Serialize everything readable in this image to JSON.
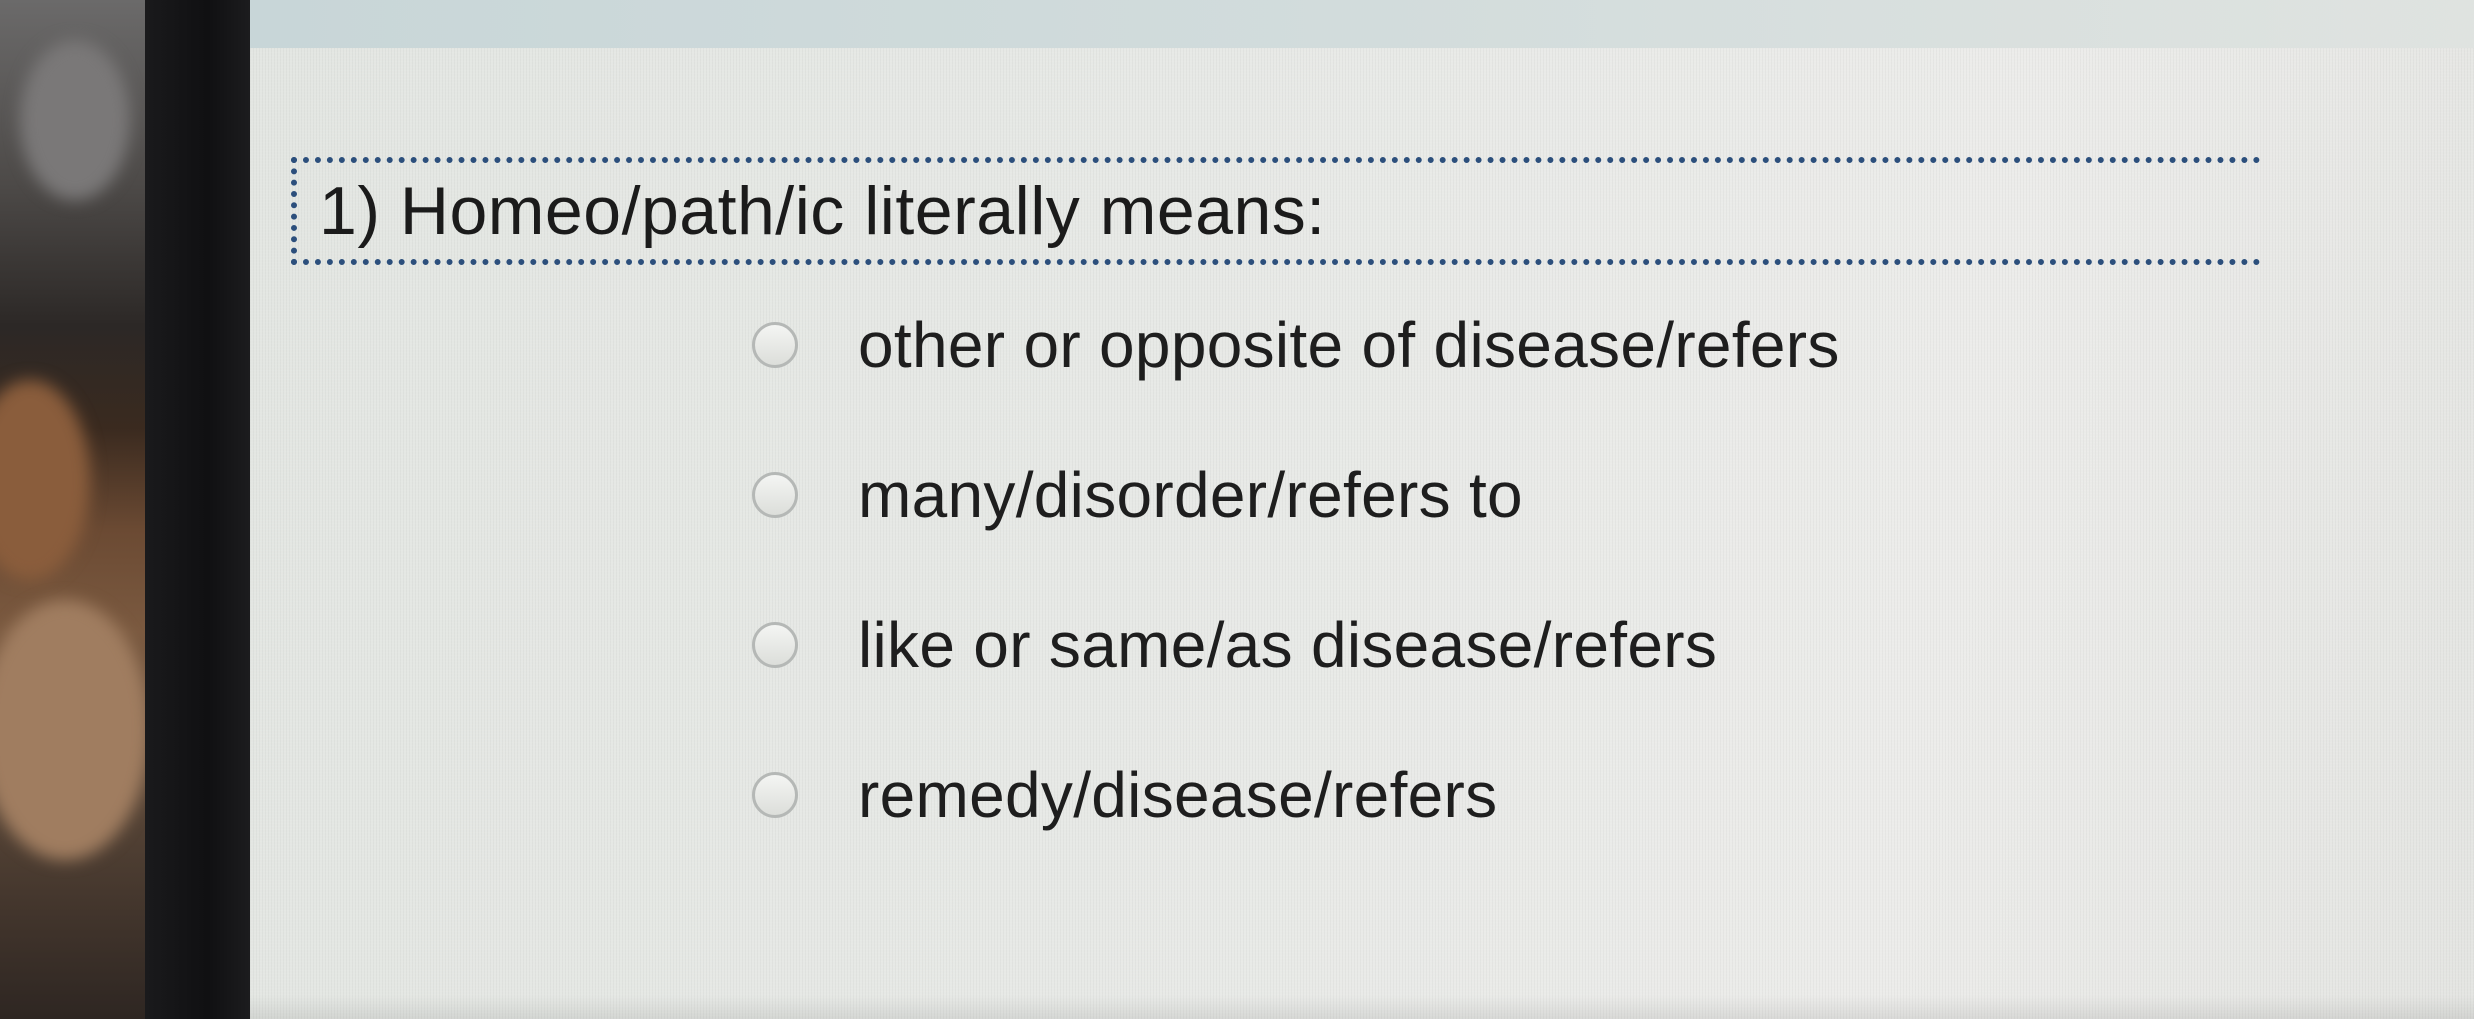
{
  "question": {
    "number": "1)",
    "text": "1) Homeo/path/ic literally means:"
  },
  "options": [
    {
      "label": "other or opposite of disease/refers",
      "selected": false
    },
    {
      "label": "many/disorder/refers to",
      "selected": false
    },
    {
      "label": "like or same/as disease/refers",
      "selected": false
    },
    {
      "label": "remedy/disease/refers",
      "selected": false
    }
  ]
}
